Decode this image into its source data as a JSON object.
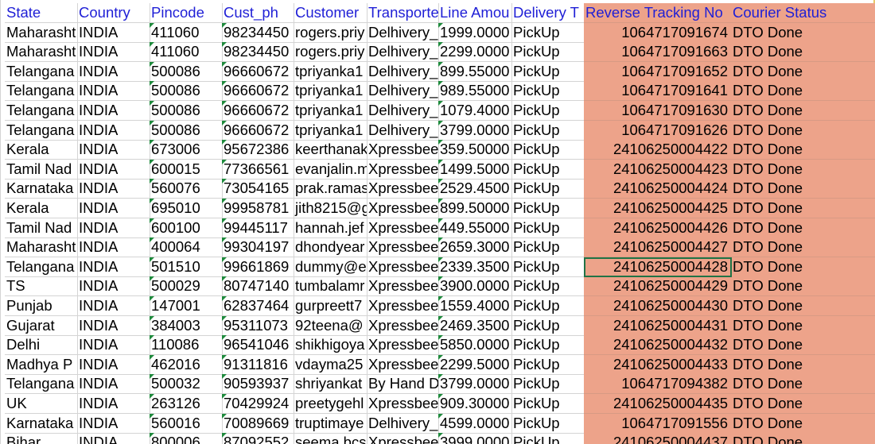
{
  "sheet": {
    "headers": [
      {
        "key": "state",
        "label": "State"
      },
      {
        "key": "country",
        "label": "Country"
      },
      {
        "key": "pincode",
        "label": "Pincode"
      },
      {
        "key": "cust_ph",
        "label": "Cust_ph"
      },
      {
        "key": "customer",
        "label": "Customer"
      },
      {
        "key": "transport",
        "label": "Transporte"
      },
      {
        "key": "line_amount",
        "label": "Line Amou"
      },
      {
        "key": "delivery",
        "label": "Delivery T"
      },
      {
        "key": "reverse_tracking",
        "label": "Reverse Tracking No"
      },
      {
        "key": "courier_status",
        "label": "Courier Status"
      }
    ],
    "rows": [
      [
        "Maharasht",
        "INDIA",
        "411060",
        "98234450",
        "rogers.priy",
        "Delhivery_",
        "1999.0000",
        "PickUp",
        "1064717091674",
        "DTO Done"
      ],
      [
        "Maharasht",
        "INDIA",
        "411060",
        "98234450",
        "rogers.priy",
        "Delhivery_",
        "2299.0000",
        "PickUp",
        "1064717091663",
        "DTO Done"
      ],
      [
        "Telangana",
        "INDIA",
        "500086",
        "96660672",
        "tpriyanka1",
        "Delhivery_",
        "899.55000",
        "PickUp",
        "1064717091652",
        "DTO Done"
      ],
      [
        "Telangana",
        "INDIA",
        "500086",
        "96660672",
        "tpriyanka1",
        "Delhivery_",
        "989.55000",
        "PickUp",
        "1064717091641",
        "DTO Done"
      ],
      [
        "Telangana",
        "INDIA",
        "500086",
        "96660672",
        "tpriyanka1",
        "Delhivery_",
        "1079.4000",
        "PickUp",
        "1064717091630",
        "DTO Done"
      ],
      [
        "Telangana",
        "INDIA",
        "500086",
        "96660672",
        "tpriyanka1",
        "Delhivery_",
        "3799.0000",
        "PickUp",
        "1064717091626",
        "DTO Done"
      ],
      [
        "Kerala",
        "INDIA",
        "673006",
        "95672386",
        "keerthanak",
        "Xpressbee",
        "359.50000",
        "PickUp",
        "24106250004422",
        "DTO Done"
      ],
      [
        "Tamil Nad",
        "INDIA",
        "600015",
        "77366561",
        "evanjalin.m",
        "Xpressbee",
        "1499.5000",
        "PickUp",
        "24106250004423",
        "DTO Done"
      ],
      [
        "Karnataka",
        "INDIA",
        "560076",
        "73054165",
        "prak.ramas",
        "Xpressbee",
        "2529.4500",
        "PickUp",
        "24106250004424",
        "DTO Done"
      ],
      [
        "Kerala",
        "INDIA",
        "695010",
        "99958781",
        "jith8215@g",
        "Xpressbee",
        "899.50000",
        "PickUp",
        "24106250004425",
        "DTO Done"
      ],
      [
        "Tamil Nad",
        "INDIA",
        "600100",
        "99445117",
        "hannah.jef",
        "Xpressbee",
        "449.55000",
        "PickUp",
        "24106250004426",
        "DTO Done"
      ],
      [
        "Maharasht",
        "INDIA",
        "400064",
        "99304197",
        "dhondyear",
        "Xpressbee",
        "2659.3000",
        "PickUp",
        "24106250004427",
        "DTO Done"
      ],
      [
        "Telangana",
        "INDIA",
        "501510",
        "99661869",
        "dummy@e",
        "Xpressbee",
        "2339.3500",
        "PickUp",
        "24106250004428",
        "DTO Done"
      ],
      [
        "TS",
        "INDIA",
        "500029",
        "80747140",
        "tumbalamr",
        "Xpressbee",
        "3900.0000",
        "PickUp",
        "24106250004429",
        "DTO Done"
      ],
      [
        "Punjab",
        "INDIA",
        "147001",
        "62837464",
        "gurpreett7",
        "Xpressbee",
        "1559.4000",
        "PickUp",
        "24106250004430",
        "DTO Done"
      ],
      [
        "Gujarat",
        "INDIA",
        "384003",
        "95311073",
        "92teena@",
        "Xpressbee",
        "2469.3500",
        "PickUp",
        "24106250004431",
        "DTO Done"
      ],
      [
        "Delhi",
        "INDIA",
        "110086",
        "96541046",
        "shikhigoya",
        "Xpressbee",
        "5850.0000",
        "PickUp",
        "24106250004432",
        "DTO Done"
      ],
      [
        "Madhya P",
        "INDIA",
        "462016",
        "91311816",
        "vdayma25",
        "Xpressbee",
        "2299.5000",
        "PickUp",
        "24106250004433",
        "DTO Done"
      ],
      [
        "Telangana",
        "INDIA",
        "500032",
        "90593937",
        "shriyankat",
        "By Hand D",
        "3799.0000",
        "PickUp",
        "1064717094382",
        "DTO Done"
      ],
      [
        "UK",
        "INDIA",
        "263126",
        "70429924",
        "preetygehl",
        "Xpressbee",
        "909.30000",
        "PickUp",
        "24106250004435",
        "DTO Done"
      ],
      [
        "Karnataka",
        "INDIA",
        "560016",
        "70089669",
        "truptimaye",
        "Delhivery_",
        "4599.0000",
        "PickUp",
        "1064717091556",
        "DTO Done"
      ],
      [
        "Bihar",
        "INDIA",
        "800006",
        "87092552",
        "seema.bcs",
        "Xpressbee",
        "3999.0000",
        "PickUp",
        "24106250004437",
        "DTO Done"
      ]
    ],
    "selected_cell": {
      "row": 12,
      "col": 8
    },
    "colors": {
      "header_text": "#1f1fd6",
      "highlight_fill": "#eda38a",
      "selection_border": "#217346",
      "text_flag_triangle": "#1e8a3c"
    }
  }
}
